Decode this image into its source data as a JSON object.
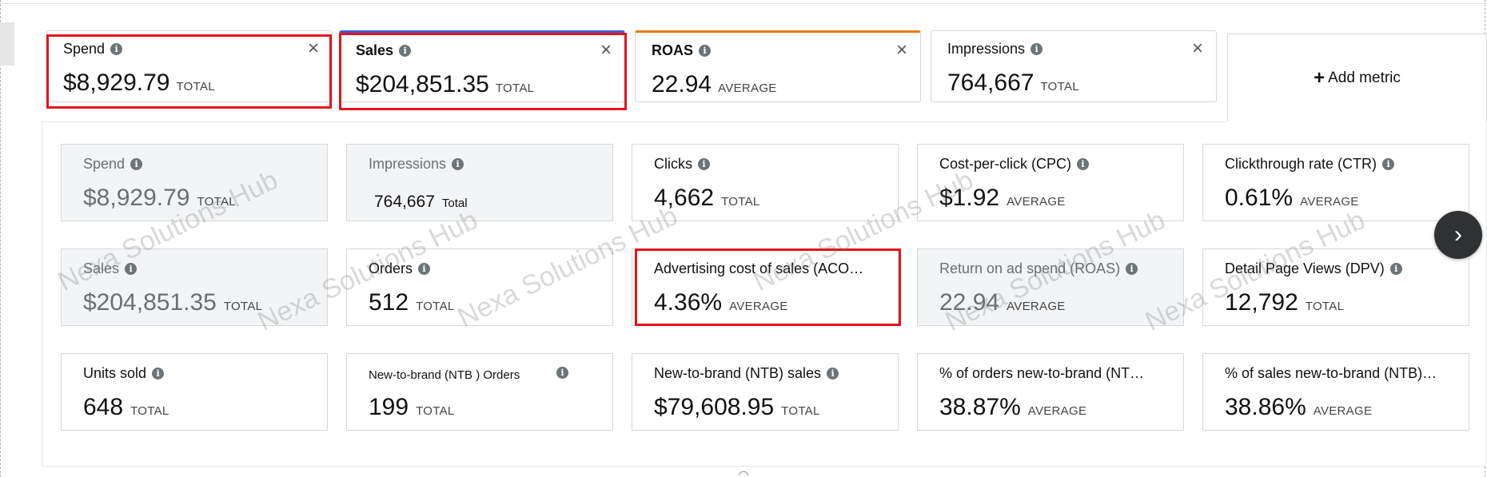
{
  "tabs": [
    {
      "title": "Spend",
      "value": "$8,929.79",
      "agg": "TOTAL",
      "close": "×"
    },
    {
      "title": "Sales",
      "value": "$204,851.35",
      "agg": "TOTAL",
      "close": "×"
    },
    {
      "title": "ROAS",
      "value": "22.94",
      "agg": "AVERAGE",
      "close": "×"
    },
    {
      "title": "Impressions",
      "value": "764,667",
      "agg": "TOTAL",
      "close": "×"
    }
  ],
  "add_metric": {
    "plus": "+",
    "label": "Add metric"
  },
  "info_glyph": "i",
  "cards": [
    {
      "label": "Spend",
      "value": "$8,929.79",
      "agg": "TOTAL"
    },
    {
      "label": "Impressions",
      "value": "764,667",
      "agg": "Total"
    },
    {
      "label": "Clicks",
      "value": "4,662",
      "agg": "TOTAL"
    },
    {
      "label": "Cost-per-click (CPC)",
      "value": "$1.92",
      "agg": "AVERAGE"
    },
    {
      "label": "Clickthrough rate (CTR)",
      "value": "0.61%",
      "agg": "AVERAGE"
    },
    {
      "label": "Sales",
      "value": "$204,851.35",
      "agg": "TOTAL"
    },
    {
      "label": "Orders",
      "value": "512",
      "agg": "TOTAL"
    },
    {
      "label": "Advertising cost of sales (ACO…",
      "value": "4.36%",
      "agg": "AVERAGE"
    },
    {
      "label": "Return on ad spend (ROAS)",
      "value": "22.94",
      "agg": "AVERAGE"
    },
    {
      "label": "Detail Page Views (DPV)",
      "value": "12,792",
      "agg": "TOTAL"
    },
    {
      "label": "Units sold",
      "value": "648",
      "agg": "TOTAL"
    },
    {
      "label": "New-to-brand (NTB ) Orders",
      "value": "199",
      "agg": "TOTAL"
    },
    {
      "label": "New-to-brand (NTB) sales",
      "value": "$79,608.95",
      "agg": "TOTAL"
    },
    {
      "label": "% of orders new-to-brand (NT…",
      "value": "38.87%",
      "agg": "AVERAGE"
    },
    {
      "label": "% of sales new-to-brand (NTB)…",
      "value": "38.86%",
      "agg": "AVERAGE"
    }
  ],
  "watermark": "Nexa Solutions Hub",
  "next_button": "›",
  "colors": {
    "highlight": "#e3141b",
    "tab_accent_blue": "#3b5bdb",
    "tab_accent_orange": "#e47911",
    "next_button": "#2f3133"
  },
  "icons": [
    "info-icon",
    "close-icon",
    "plus-icon",
    "chevron-right-icon"
  ]
}
